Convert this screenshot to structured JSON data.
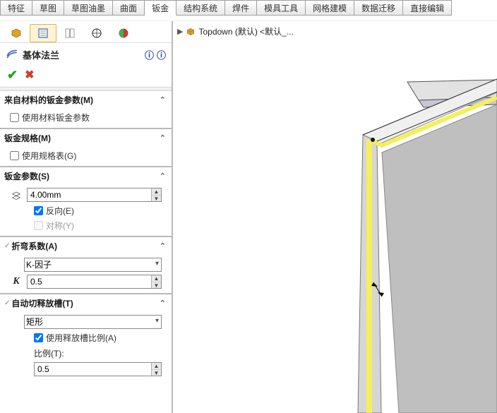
{
  "tabs": {
    "t0": "特征",
    "t1": "草图",
    "t2": "草图油墨",
    "t3": "曲面",
    "t4": "钣金",
    "t5": "结构系统",
    "t6": "焊件",
    "t7": "模具工具",
    "t8": "网格建模",
    "t9": "数据迁移",
    "t10": "直接编辑"
  },
  "feature": {
    "title": "基体法兰"
  },
  "tree": {
    "node": "Topdown (默认) <默认_..."
  },
  "sections": {
    "sheetMetalFromMaterial": {
      "header": "来自材料的钣金参数(M)",
      "useMaterial": "使用材料钣金参数"
    },
    "sheetMetalGauges": {
      "header": "钣金规格(M)",
      "useGauge": "使用规格表(G)"
    },
    "sheetMetalParams": {
      "header": "钣金参数(S)",
      "thickness": "4.00mm",
      "reverse": "反向(E)",
      "symmetric": "对称(Y)"
    },
    "bendAllowance": {
      "header": "折弯系数(A)",
      "method": "K-因子",
      "kvalue": "0.5"
    },
    "relief": {
      "header": "自动切释放槽(T)",
      "type": "矩形",
      "useRatio": "使用释放槽比例(A)",
      "ratioLabel": "比例(T):",
      "ratioValue": "0.5"
    }
  },
  "icons": {
    "flange": "flange-icon",
    "help1": "help-context-icon",
    "help2": "help-icon"
  }
}
